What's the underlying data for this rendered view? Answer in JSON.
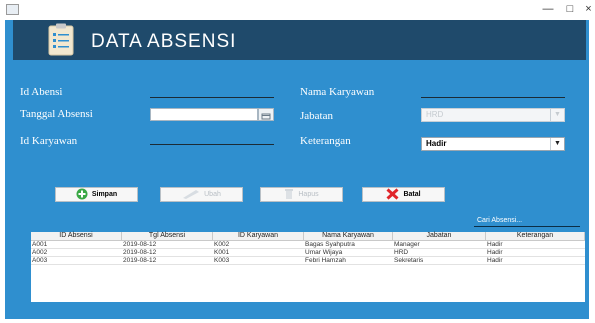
{
  "window": {
    "controls": {
      "minimize": "—",
      "maximize": "□",
      "close": "×"
    }
  },
  "header": {
    "title": "DATA ABSENSI",
    "icon": "clipboard-icon"
  },
  "form": {
    "id_absensi_label": "Id Abensi",
    "tanggal_absensi_label": "Tanggal Absensi",
    "id_karyawan_label": "Id Karyawan",
    "nama_karyawan_label": "Nama Karyawan",
    "jabatan_label": "Jabatan",
    "keterangan_label": "Keterangan",
    "jabatan_value": "HRD",
    "keterangan_value": "Hadir"
  },
  "buttons": {
    "simpan": "Simpan",
    "ubah": "Ubah",
    "hapus": "Hapus",
    "batal": "Batal"
  },
  "search": {
    "label": "Cari Absensi..."
  },
  "table": {
    "headers": [
      "ID Absensi",
      "Tgl Absensi",
      "ID Karyawan",
      "Nama Karyawan",
      "Jabatan",
      "Keterangan"
    ],
    "rows": [
      [
        "A001",
        "2019-08-12",
        "K002",
        "Bagas Syahputra",
        "Manager",
        "Hadir"
      ],
      [
        "A002",
        "2019-08-12",
        "K001",
        "Umar Wijaya",
        "HRD",
        "Hadir"
      ],
      [
        "A003",
        "2019-08-12",
        "K003",
        "Febri Hamzah",
        "Sekretaris",
        "Hadir"
      ]
    ]
  },
  "colors": {
    "panel": "#2f8fcf",
    "header": "#1f4a6b",
    "simpan_icon": "#3aa845",
    "batal_icon": "#e0252a"
  }
}
